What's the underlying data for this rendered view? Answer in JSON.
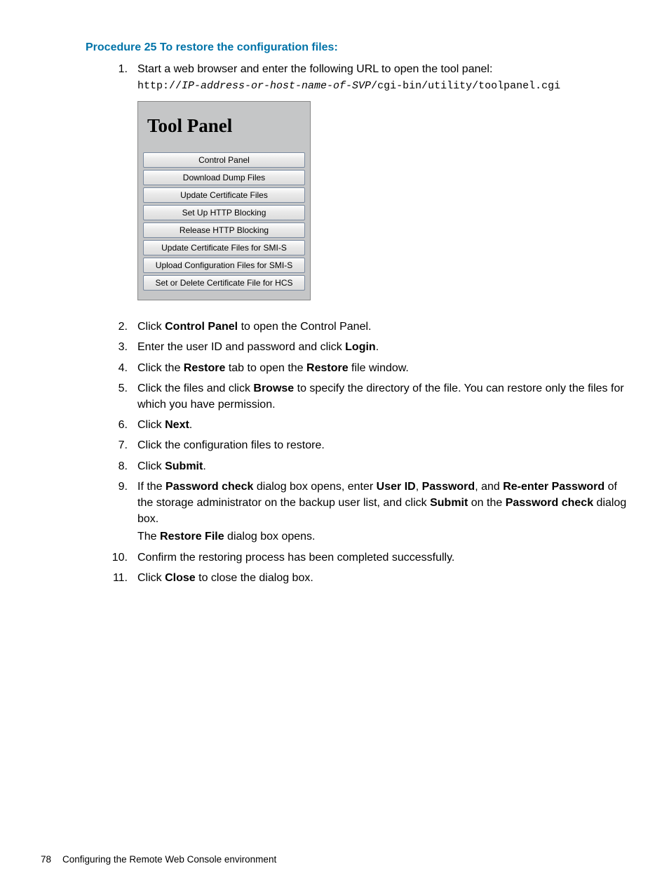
{
  "procedure_title": "Procedure 25 To restore the configuration files:",
  "steps": {
    "s1": {
      "num": "1.",
      "p1": "Start a web browser and enter the following URL to open the tool panel:",
      "url_prefix": "http://",
      "url_host": "IP-address-or-host-name-of-SVP",
      "url_suffix": "/cgi-bin/utility/toolpanel.cgi"
    },
    "s2": {
      "num": "2.",
      "pre": "Click ",
      "b1": "Control Panel",
      "post": " to open the Control Panel."
    },
    "s3": {
      "num": "3.",
      "pre": "Enter the user ID and password and click ",
      "b1": "Login",
      "post": "."
    },
    "s4": {
      "num": "4.",
      "pre": "Click the ",
      "b1": "Restore",
      "mid": " tab to open the ",
      "b2": "Restore",
      "post": " file window."
    },
    "s5": {
      "num": "5.",
      "pre": "Click the files and click ",
      "b1": "Browse",
      "post": " to specify the directory of the file. You can restore only the files for which you have permission."
    },
    "s6": {
      "num": "6.",
      "pre": "Click ",
      "b1": "Next",
      "post": "."
    },
    "s7": {
      "num": "7.",
      "text": "Click the configuration files to restore."
    },
    "s8": {
      "num": "8.",
      "pre": "Click ",
      "b1": "Submit",
      "post": "."
    },
    "s9": {
      "num": "9.",
      "t1": "If the ",
      "b1": "Password check",
      "t2": " dialog box opens, enter ",
      "b2": "User ID",
      "t3": ", ",
      "b3": "Password",
      "t4": ", and ",
      "b4": "Re-enter Password",
      "t5": " of the storage administrator on the backup user list, and click ",
      "b5": "Submit",
      "t6": " on the ",
      "b6": "Password check",
      "t7": " dialog box.",
      "p2a": "The ",
      "p2b": "Restore File",
      "p2c": " dialog box opens."
    },
    "s10": {
      "num": "10.",
      "text": "Confirm the restoring process has been completed successfully."
    },
    "s11": {
      "num": "11.",
      "pre": "Click ",
      "b1": "Close",
      "post": " to close the dialog box."
    }
  },
  "tool_panel": {
    "title": "Tool Panel",
    "buttons": {
      "b0": "Control Panel",
      "b1": "Download Dump Files",
      "b2": "Update Certificate Files",
      "b3": "Set Up HTTP Blocking",
      "b4": "Release HTTP Blocking",
      "b5": "Update Certificate Files for SMI-S",
      "b6": "Upload Configuration Files for SMI-S",
      "b7": "Set or Delete Certificate File for HCS"
    }
  },
  "footer": {
    "page_number": "78",
    "section": "Configuring the Remote Web Console environment"
  }
}
